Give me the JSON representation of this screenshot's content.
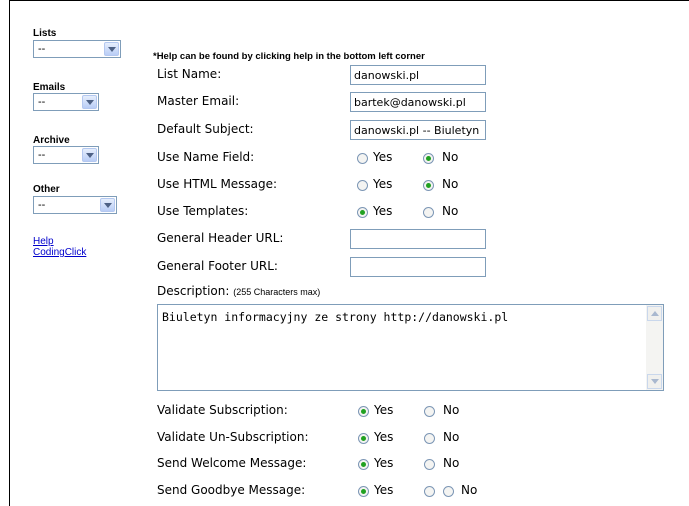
{
  "sidebar": {
    "lists": {
      "heading": "Lists",
      "value": "--"
    },
    "emails": {
      "heading": "Emails",
      "value": "--"
    },
    "archive": {
      "heading": "Archive",
      "value": "--"
    },
    "other": {
      "heading": "Other",
      "value": "--"
    },
    "links": {
      "help": "Help",
      "codingclick": "CodingClick"
    }
  },
  "form": {
    "note": "*Help can be found by clicking help in the bottom left corner",
    "list_name": {
      "label": "List Name:",
      "value": "danowski.pl"
    },
    "master_email": {
      "label": "Master Email:",
      "value": "bartek@danowski.pl"
    },
    "default_subject": {
      "label": "Default Subject:",
      "value": "danowski.pl -- Biuletyn"
    },
    "use_name_field": {
      "label": "Use Name Field:",
      "yes": "Yes",
      "no": "No",
      "selected": "No"
    },
    "use_html_message": {
      "label": "Use HTML Message:",
      "yes": "Yes",
      "no": "No",
      "selected": "No"
    },
    "use_templates": {
      "label": "Use Templates:",
      "yes": "Yes",
      "no": "No",
      "selected": "Yes"
    },
    "general_header_url": {
      "label": "General Header URL:",
      "value": ""
    },
    "general_footer_url": {
      "label": "General Footer URL:",
      "value": ""
    },
    "description": {
      "label": "Description:",
      "hint": "(255 Characters max)",
      "value": "Biuletyn informacyjny ze strony http://danowski.pl"
    },
    "validate_subscription": {
      "label": "Validate Subscription:",
      "yes": "Yes",
      "no": "No",
      "selected": "Yes"
    },
    "validate_unsubscription": {
      "label": "Validate Un-Subscription:",
      "yes": "Yes",
      "no": "No",
      "selected": "Yes"
    },
    "send_welcome_message": {
      "label": "Send Welcome Message:",
      "yes": "Yes",
      "no": "No",
      "selected": "Yes"
    },
    "send_goodbye_message": {
      "label": "Send Goodbye Message:",
      "yes": "Yes",
      "no": "No",
      "selected": "Yes"
    }
  }
}
